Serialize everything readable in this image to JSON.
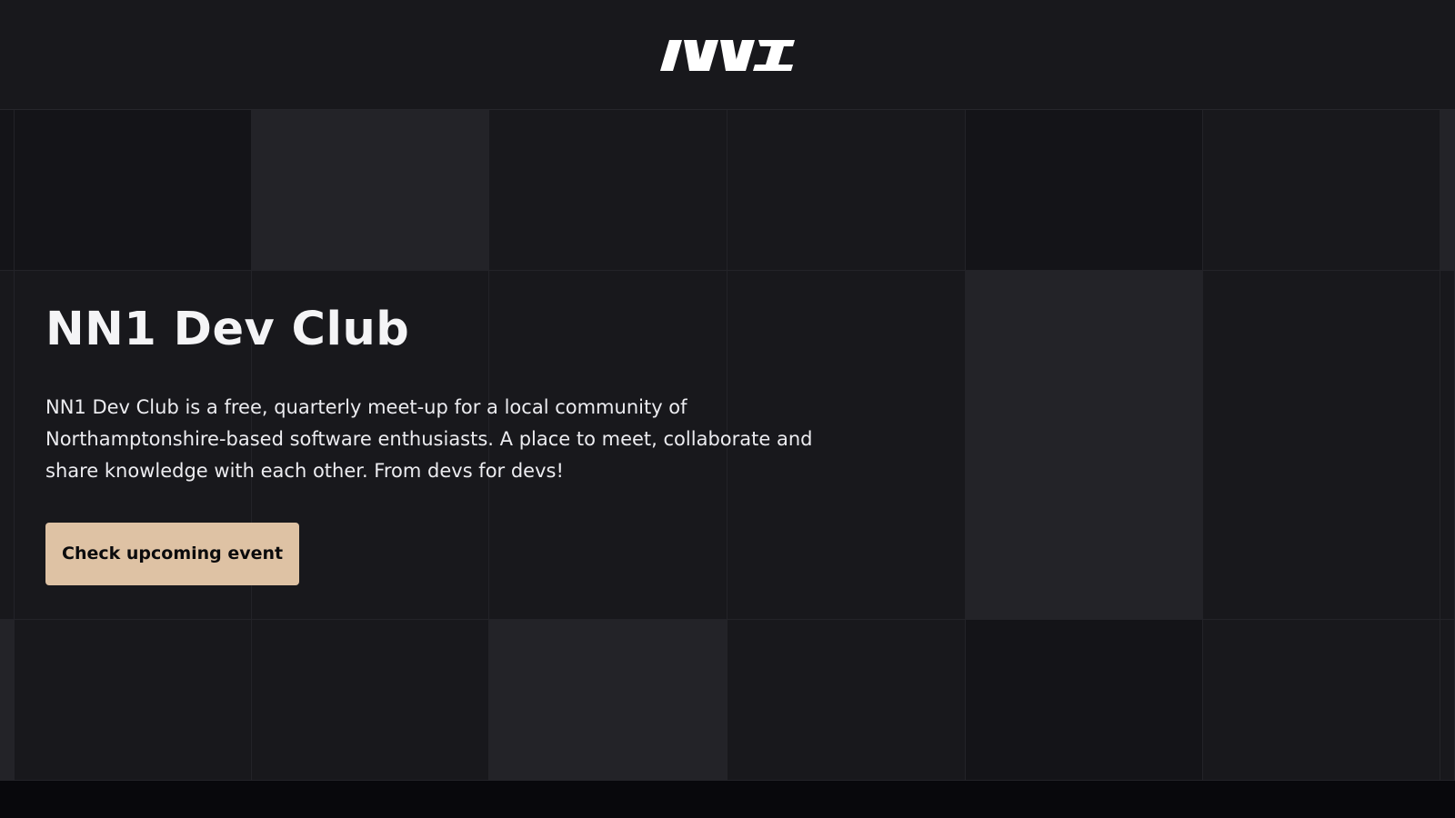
{
  "header": {
    "logo_text": "NN1",
    "logo_icon": "nn1-logo-icon"
  },
  "hero": {
    "title": "NN1 Dev Club",
    "description": "NN1 Dev Club is a free, quarterly meet-up for a local community of Northamptonshire-based software enthusiasts. A place to meet, collaborate and share knowledge with each other. From devs for devs!",
    "cta_label": "Check upcoming event"
  },
  "colors": {
    "background": "#18181c",
    "tile_light": "#232328",
    "tile_dark": "#141418",
    "text": "#f4f4f6",
    "accent": "#dec2a4"
  }
}
